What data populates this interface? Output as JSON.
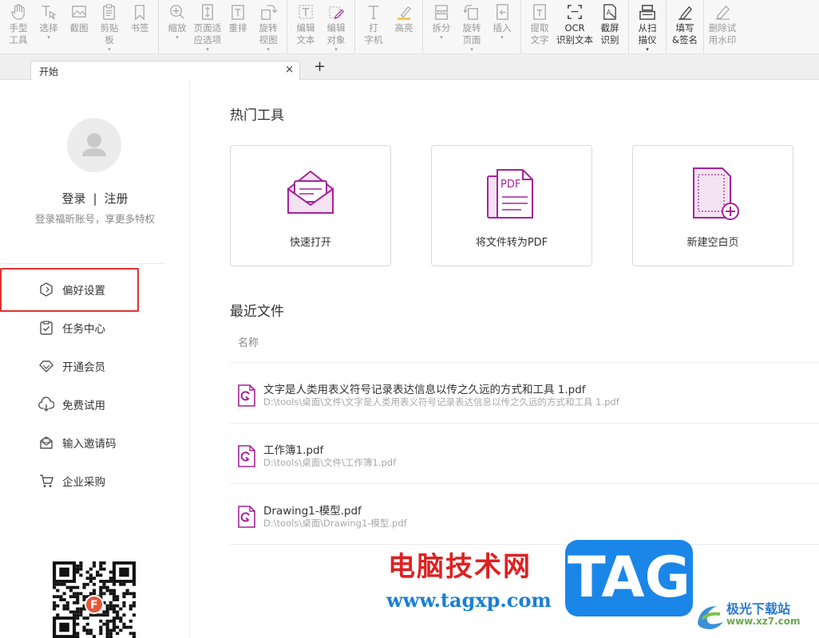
{
  "toolbar": {
    "groups": [
      [
        {
          "name": "hand-tool-button",
          "icon": "hand-icon",
          "label": "手型\n工具",
          "dd": ""
        },
        {
          "name": "select-button",
          "icon": "select-text-icon",
          "label": "选择",
          "dd": "▾"
        },
        {
          "name": "screenshot-button",
          "icon": "screenshot-icon",
          "label": "截图",
          "dd": ""
        },
        {
          "name": "clipboard-button",
          "icon": "clipboard-icon",
          "label": "剪贴\n板",
          "dd": "▾"
        },
        {
          "name": "bookmark-button",
          "icon": "bookmark-icon",
          "label": "书签",
          "dd": ""
        }
      ],
      [
        {
          "name": "zoom-button",
          "icon": "zoom-icon",
          "label": "缩放",
          "dd": "▾"
        },
        {
          "name": "fit-page-button",
          "icon": "fit-page-icon",
          "label": "页面适\n应选项",
          "dd": "▾"
        },
        {
          "name": "reflow-button",
          "icon": "reflow-icon",
          "label": "重排",
          "dd": ""
        },
        {
          "name": "rotate-view-button",
          "icon": "rotate-view-icon",
          "label": "旋转\n视图",
          "dd": "▾"
        }
      ],
      [
        {
          "name": "edit-text-button",
          "icon": "edit-text-icon",
          "label": "编辑\n文本",
          "dd": ""
        },
        {
          "name": "edit-object-button",
          "icon": "edit-object-icon",
          "label": "编辑\n对象",
          "dd": "▾"
        }
      ],
      [
        {
          "name": "typewriter-button",
          "icon": "typewriter-icon",
          "label": "打\n字机",
          "dd": ""
        },
        {
          "name": "highlight-button",
          "icon": "highlight-icon",
          "label": "高亮",
          "dd": ""
        }
      ],
      [
        {
          "name": "split-button",
          "icon": "split-icon",
          "label": "拆分",
          "dd": "▾"
        },
        {
          "name": "rotate-page-button",
          "icon": "rotate-page-icon",
          "label": "旋转\n页面",
          "dd": "▾"
        },
        {
          "name": "insert-button",
          "icon": "insert-icon",
          "label": "插入",
          "dd": "▾"
        }
      ],
      [
        {
          "name": "extract-text-button",
          "icon": "extract-text-icon",
          "label": "提取\n文字",
          "dd": ""
        },
        {
          "name": "ocr-button",
          "icon": "ocr-icon",
          "label": "OCR\n识别文本",
          "dd": "",
          "dark": true
        },
        {
          "name": "screen-ocr-button",
          "icon": "screen-ocr-icon",
          "label": "截屏\n识别",
          "dd": "",
          "dark": true
        }
      ],
      [
        {
          "name": "scan-button",
          "icon": "scanner-icon",
          "label": "从扫\n描仪",
          "dd": "▾",
          "dark": true
        }
      ],
      [
        {
          "name": "fill-sign-button",
          "icon": "pen-sign-icon",
          "label": "填写\n&签名",
          "dd": "",
          "dark": true
        }
      ],
      [
        {
          "name": "remove-watermark-button",
          "icon": "remove-watermark-icon",
          "label": "删除试\n用水印",
          "dd": ""
        }
      ]
    ]
  },
  "tabs": {
    "active_label": "开始",
    "close": "×",
    "add": "+"
  },
  "sidebar": {
    "login": "登录",
    "separator": "|",
    "register": "注册",
    "login_hint": "登录福昕账号，享更多特权",
    "menu": [
      {
        "name": "menu-item-preferences",
        "icon": "cube-icon",
        "label": "偏好设置"
      },
      {
        "name": "menu-item-task-center",
        "icon": "clipboard-check-icon",
        "label": "任务中心"
      },
      {
        "name": "menu-item-membership",
        "icon": "diamond-icon",
        "label": "开通会员"
      },
      {
        "name": "menu-item-free-trial",
        "icon": "cloud-download-icon",
        "label": "免费试用"
      },
      {
        "name": "menu-item-invite-code",
        "icon": "mail-open-icon",
        "label": "输入邀请码"
      },
      {
        "name": "menu-item-enterprise",
        "icon": "cart-icon",
        "label": "企业采购"
      }
    ]
  },
  "main": {
    "hot_tools_title": "热门工具",
    "tools": [
      {
        "name": "quick-open-card",
        "icon": "envelope-icon",
        "label": "快速打开"
      },
      {
        "name": "convert-to-pdf-card",
        "icon": "pdf-document-icon",
        "label": "将文件转为PDF"
      },
      {
        "name": "new-blank-page-card",
        "icon": "blank-page-plus-icon",
        "label": "新建空白页"
      }
    ],
    "recent_title": "最近文件",
    "column_name": "名称",
    "files": [
      {
        "name": "文字是人类用表义符号记录表达信息以传之久远的方式和工具 1.pdf",
        "path": "D:\\tools\\桌面\\文件\\文字是人类用表义符号记录表达信息以传之久远的方式和工具 1.pdf"
      },
      {
        "name": "工作簿1.pdf",
        "path": "D:\\tools\\桌面\\文件\\工作簿1.pdf"
      },
      {
        "name": "Drawing1-模型.pdf",
        "path": "D:\\tools\\桌面\\Drawing1-模型.pdf"
      }
    ]
  },
  "watermark": {
    "cn": "电脑技术网",
    "url": "www.tagxp.com",
    "tag": "TAG",
    "site_cn": "极光下载站",
    "site_url": "www.xz7.com"
  },
  "colors": {
    "accent_purple": "#a3249a",
    "highlight_red": "#e33131",
    "toolbar_bg": "#f7f7f7"
  }
}
